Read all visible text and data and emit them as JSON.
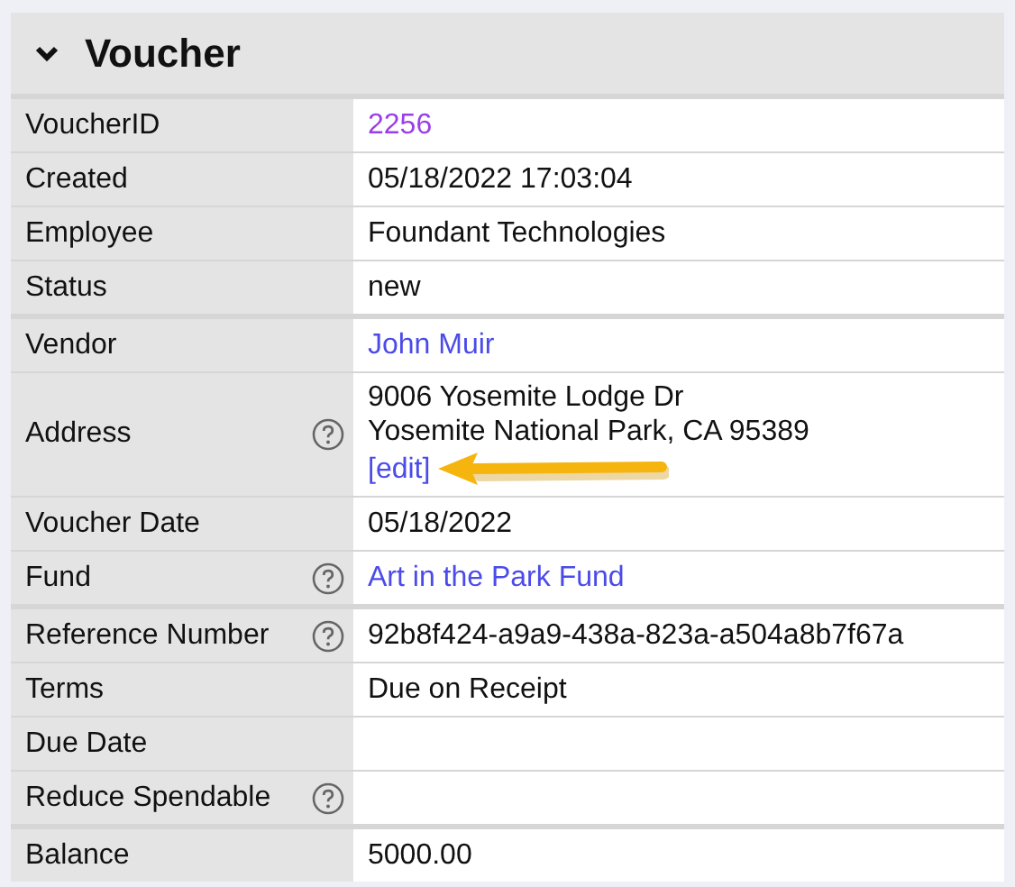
{
  "panel": {
    "title": "Voucher",
    "expanded": true
  },
  "rows": [
    {
      "label": "VoucherID",
      "help": false,
      "divider_above": true,
      "kind": "visited_link",
      "value": "2256"
    },
    {
      "label": "Created",
      "help": false,
      "divider_above": false,
      "kind": "text",
      "value": "05/18/2022 17:03:04"
    },
    {
      "label": "Employee",
      "help": false,
      "divider_above": false,
      "kind": "text",
      "value": "Foundant Technologies"
    },
    {
      "label": "Status",
      "help": false,
      "divider_above": false,
      "kind": "text",
      "value": "new"
    },
    {
      "label": "Vendor",
      "help": false,
      "divider_above": true,
      "kind": "link",
      "value": "John Muir"
    },
    {
      "label": "Address",
      "help": true,
      "divider_above": false,
      "kind": "address",
      "lines": [
        "9006 Yosemite Lodge Dr",
        "Yosemite National Park, CA 95389"
      ],
      "edit_link": "[edit]"
    },
    {
      "label": "Voucher Date",
      "help": false,
      "divider_above": false,
      "kind": "text",
      "value": "05/18/2022"
    },
    {
      "label": "Fund",
      "help": true,
      "divider_above": false,
      "kind": "link",
      "value": "Art in the Park Fund"
    },
    {
      "label": "Reference Number",
      "help": true,
      "divider_above": true,
      "kind": "text",
      "value": "92b8f424-a9a9-438a-823a-a504a8b7f67a"
    },
    {
      "label": "Terms",
      "help": false,
      "divider_above": false,
      "kind": "text",
      "value": "Due on Receipt"
    },
    {
      "label": "Due Date",
      "help": false,
      "divider_above": false,
      "kind": "text"
    },
    {
      "label": "Reduce Spendable",
      "help": true,
      "divider_above": false,
      "kind": "text"
    },
    {
      "label": "Balance",
      "help": false,
      "divider_above": true,
      "kind": "text",
      "value": "5000.00"
    }
  ]
}
